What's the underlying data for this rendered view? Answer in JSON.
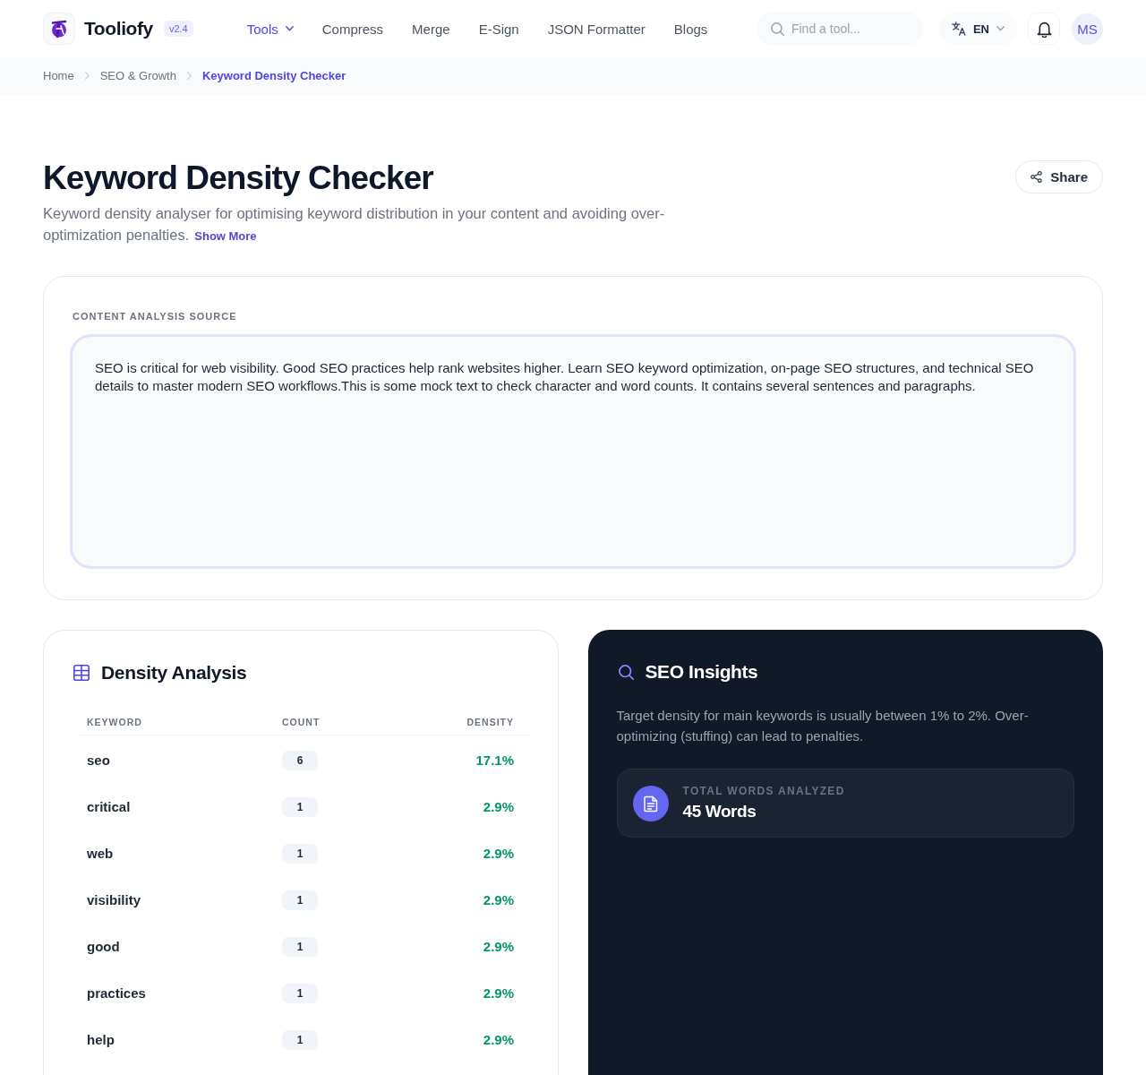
{
  "header": {
    "logo": {
      "name": "Tooliofy",
      "version": "v2.4"
    },
    "nav": [
      {
        "label": "Tools",
        "kind": "dropdown",
        "selected": true
      },
      {
        "label": "Compress",
        "kind": "link",
        "selected": false
      },
      {
        "label": "Merge",
        "kind": "link",
        "selected": false
      },
      {
        "label": "E-Sign",
        "kind": "link",
        "selected": false
      },
      {
        "label": "JSON Formatter",
        "kind": "link",
        "selected": false
      },
      {
        "label": "Blogs",
        "kind": "link",
        "selected": false
      }
    ],
    "search": {
      "placeholder": "Find a tool..."
    },
    "language": "EN",
    "avatar": "MS"
  },
  "breadcrumb": [
    {
      "label": "Home",
      "selected": false
    },
    {
      "label": "SEO & Growth",
      "selected": false
    },
    {
      "label": "Keyword Density Checker",
      "selected": true
    }
  ],
  "page": {
    "title": "Keyword Density Checker",
    "description": "Keyword density analyser for optimising keyword distribution in your content and avoiding over-optimization penalties.",
    "show_more": "Show More",
    "share": "Share"
  },
  "source": {
    "label": "CONTENT ANALYSIS SOURCE",
    "value": "SEO is critical for web visibility. Good SEO practices help rank websites higher. Learn SEO keyword optimization, on-page SEO structures, and technical SEO details to master modern SEO workflows.This is some mock text to check character and word counts. It contains several sentences and paragraphs."
  },
  "density": {
    "title": "Density Analysis",
    "columns": [
      "KEYWORD",
      "COUNT",
      "DENSITY"
    ],
    "rows": [
      {
        "keyword": "seo",
        "count": "6",
        "density": "17.1%"
      },
      {
        "keyword": "critical",
        "count": "1",
        "density": "2.9%"
      },
      {
        "keyword": "web",
        "count": "1",
        "density": "2.9%"
      },
      {
        "keyword": "visibility",
        "count": "1",
        "density": "2.9%"
      },
      {
        "keyword": "good",
        "count": "1",
        "density": "2.9%"
      },
      {
        "keyword": "practices",
        "count": "1",
        "density": "2.9%"
      },
      {
        "keyword": "help",
        "count": "1",
        "density": "2.9%"
      }
    ]
  },
  "insights": {
    "title": "SEO Insights",
    "text": "Target density for main keywords is usually between 1% to 2%. Over-optimizing (stuffing) can lead to penalties.",
    "stat": {
      "label": "TOTAL WORDS ANALYZED",
      "value": "45 Words"
    }
  }
}
